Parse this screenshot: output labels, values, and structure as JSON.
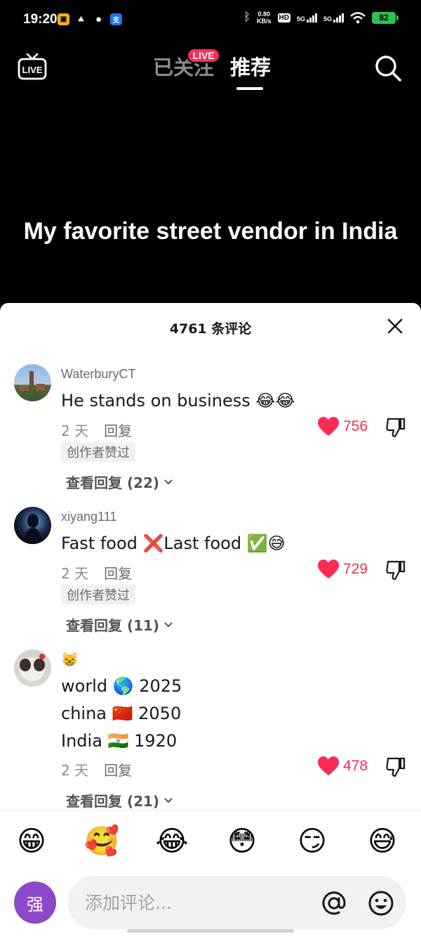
{
  "status": {
    "time": "19:20",
    "net_speed_value": "0.80",
    "net_speed_unit": "KB/s",
    "hd_label": "HD",
    "signal1": "5G",
    "signal2": "5G",
    "battery": "82"
  },
  "nav": {
    "live_icon_label": "LIVE",
    "following": "已关注",
    "live_badge": "LIVE",
    "recommend": "推荐"
  },
  "video": {
    "caption": "My favorite street vendor in India"
  },
  "comments_header": {
    "count_title": "4761 条评论"
  },
  "comments": [
    {
      "user": "WaterburyCT",
      "text": "He stands on business 😂😂",
      "time": "2 天",
      "reply": "回复",
      "likes": "756",
      "creator_liked": "创作者赞过",
      "view_replies": "查看回复 (22)"
    },
    {
      "user": "xiyang111",
      "text": "Fast food ❌Last food ✅😅",
      "time": "2 天",
      "reply": "回复",
      "likes": "729",
      "creator_liked": "创作者赞过",
      "view_replies": "查看回复 (11)"
    },
    {
      "user": "😸",
      "text_lines": [
        "world 🌎 2025",
        "china 🇨🇳 2050",
        "India 🇮🇳 1920"
      ],
      "time": "2 天",
      "reply": "回复",
      "likes": "478",
      "view_replies": "查看回复 (21)"
    }
  ],
  "emoji_bar": [
    "😁",
    "🥰",
    "😂",
    "😳",
    "😏",
    "😅"
  ],
  "input": {
    "avatar_letter": "强",
    "placeholder": "添加评论..."
  },
  "colors": {
    "accent": "#fe2c55",
    "avatar_bg": "#8c49c9",
    "battery": "#2fc04f"
  },
  "icons": [
    "live-tv-icon",
    "search-icon",
    "close-icon",
    "heart-icon",
    "dislike-icon",
    "chevron-down-icon",
    "mention-icon",
    "emoji-picker-icon"
  ]
}
